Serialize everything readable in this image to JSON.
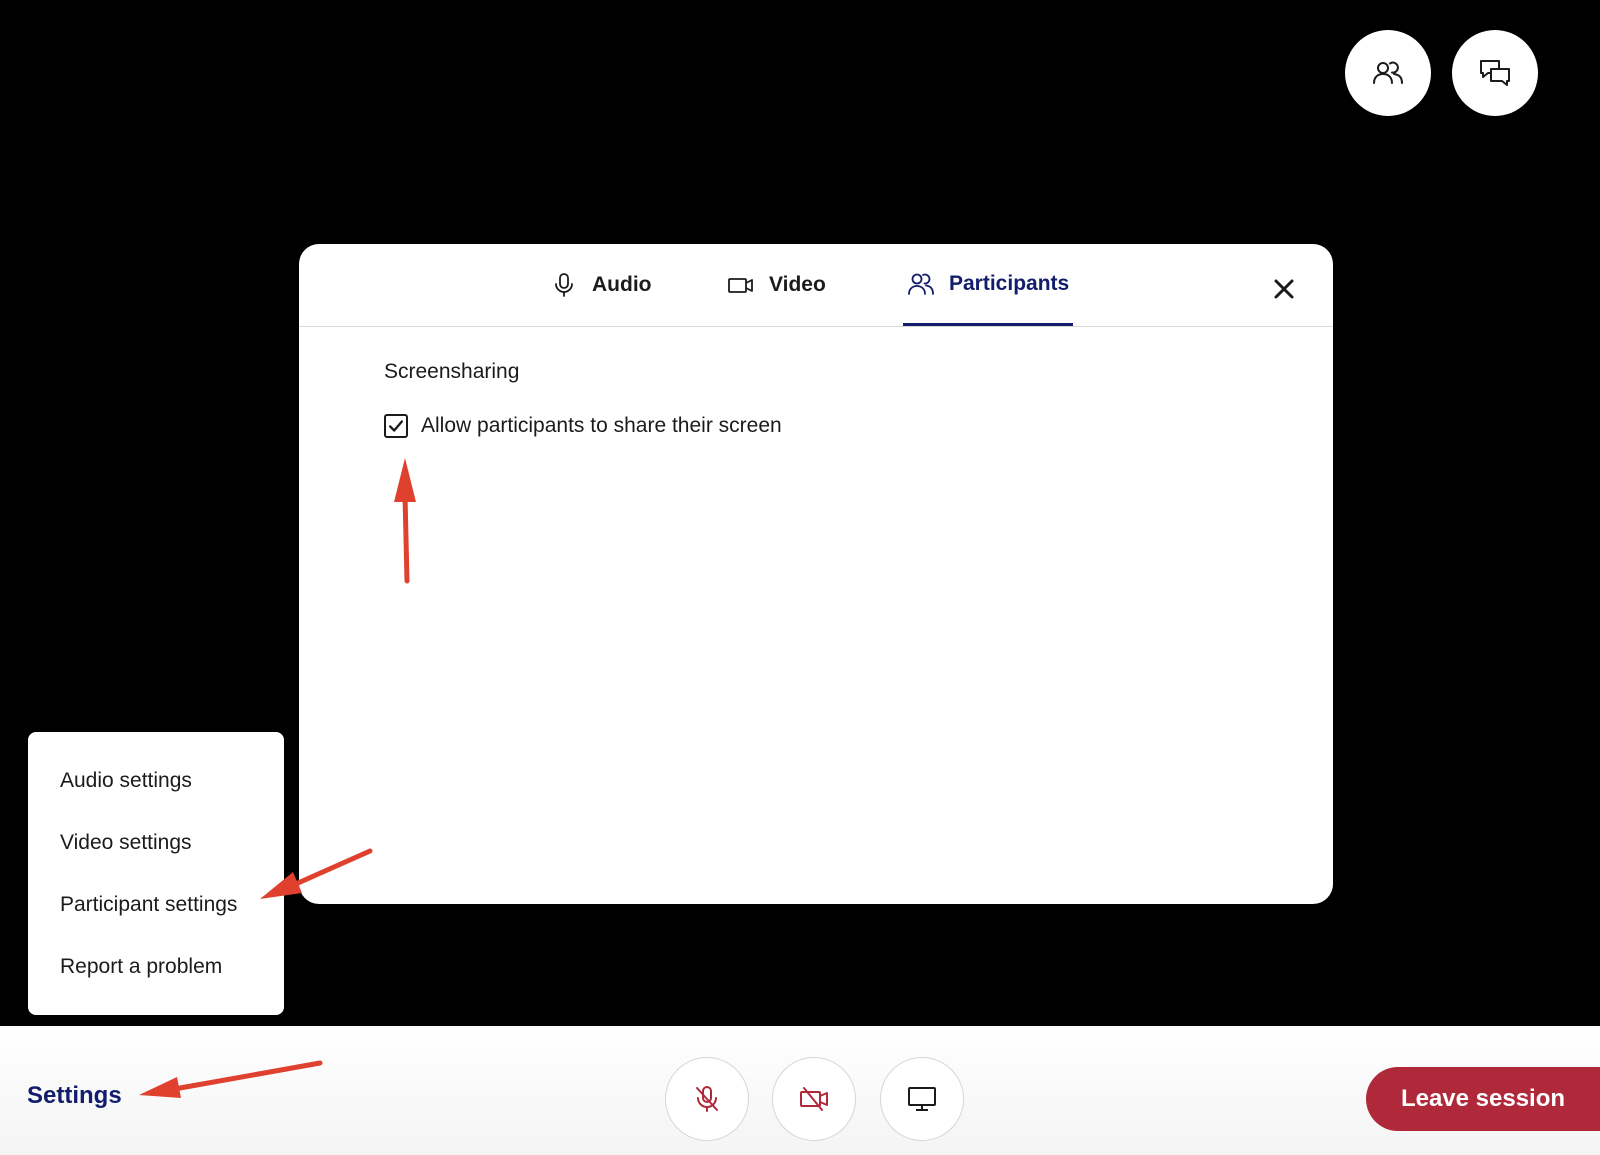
{
  "top_buttons": {
    "participants_icon": "participants-icon",
    "chat_icon": "chat-icon"
  },
  "modal": {
    "tabs": [
      {
        "label": "Audio",
        "icon": "microphone-icon",
        "active": false
      },
      {
        "label": "Video",
        "icon": "video-camera-icon",
        "active": false
      },
      {
        "label": "Participants",
        "icon": "participants-icon",
        "active": true
      }
    ],
    "close_icon": "close-icon",
    "section_title": "Screensharing",
    "checkbox": {
      "label": "Allow participants to share their screen",
      "checked": true
    }
  },
  "menu": {
    "items": [
      {
        "label": "Audio settings"
      },
      {
        "label": "Video settings"
      },
      {
        "label": "Participant settings"
      },
      {
        "label": "Report a problem"
      }
    ]
  },
  "bottom": {
    "settings_label": "Settings",
    "leave_label": "Leave session"
  },
  "colors": {
    "accent": "#121d6b",
    "leave": "#b0293a",
    "annotation": "#e0402e",
    "mic_off": "#b0293a"
  }
}
